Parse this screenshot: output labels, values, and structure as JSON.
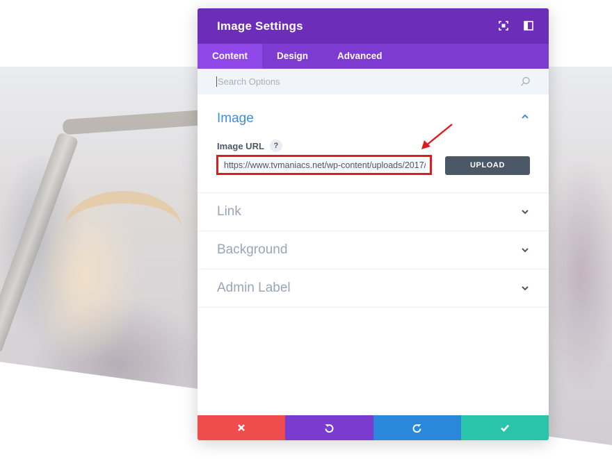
{
  "modal": {
    "title": "Image Settings",
    "header_icons": [
      "focus-mode-icon",
      "sidebar-layout-icon"
    ]
  },
  "tabs": [
    {
      "label": "Content",
      "active": true
    },
    {
      "label": "Design",
      "active": false
    },
    {
      "label": "Advanced",
      "active": false
    }
  ],
  "search": {
    "placeholder": "Search Options"
  },
  "sections": {
    "image": {
      "title": "Image",
      "expanded": true,
      "field_label": "Image URL",
      "help": "?",
      "url_value": "https://www.tvmaniacs.net/wp-content/uploads/2017/",
      "upload_label": "UPLOAD"
    },
    "link": {
      "title": "Link",
      "expanded": false
    },
    "background": {
      "title": "Background",
      "expanded": false
    },
    "admin_label": {
      "title": "Admin Label",
      "expanded": false
    }
  },
  "footer": {
    "buttons": [
      "cancel-icon",
      "undo-icon",
      "redo-icon",
      "save-icon"
    ]
  },
  "colors": {
    "header": "#6c2eb9",
    "tabs_bar": "#7d3bd2",
    "active_tab": "#8f47e8",
    "section_open": "#3e8fd6",
    "section_closed": "#9aa5b8",
    "upload_button": "#4b5867",
    "highlight_border": "#e11b1b",
    "cancel": "#ef4d4d",
    "undo": "#7a3bcf",
    "redo": "#2b87da",
    "save": "#29c4a9"
  }
}
